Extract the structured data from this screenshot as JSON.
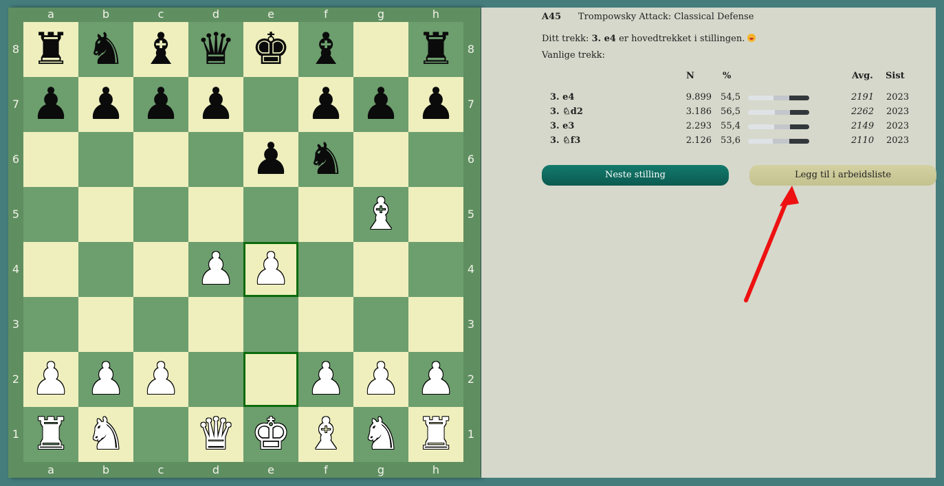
{
  "board": {
    "files": [
      "a",
      "b",
      "c",
      "d",
      "e",
      "f",
      "g",
      "h"
    ],
    "ranks": [
      "8",
      "7",
      "6",
      "5",
      "4",
      "3",
      "2",
      "1"
    ],
    "highlight_squares": [
      "e4",
      "e2"
    ],
    "pieces": {
      "a8": "bR",
      "b8": "bN",
      "c8": "bB",
      "d8": "bQ",
      "e8": "bK",
      "f8": "bB",
      "h8": "bR",
      "a7": "bP",
      "b7": "bP",
      "c7": "bP",
      "d7": "bP",
      "f7": "bP",
      "g7": "bP",
      "h7": "bP",
      "e6": "bP",
      "f6": "bN",
      "g5": "wB",
      "d4": "wP",
      "e4": "wP",
      "a2": "wP",
      "b2": "wP",
      "c2": "wP",
      "f2": "wP",
      "g2": "wP",
      "h2": "wP",
      "a1": "wR",
      "b1": "wN",
      "d1": "wQ",
      "e1": "wK",
      "f1": "wB",
      "g1": "wN",
      "h1": "wR"
    },
    "glyphs": {
      "K": "♚",
      "Q": "♛",
      "R": "♜",
      "B": "♝",
      "N": "♞",
      "P": "♟"
    }
  },
  "panel": {
    "eco": "A45",
    "opening": "Trompowsky Attack: Classical Defense",
    "your_move_prefix": "Ditt trekk: ",
    "your_move": "3. e4",
    "your_move_suffix": " er hovedtrekket i stillingen.",
    "common_moves_label": "Vanlige trekk:",
    "headers": {
      "n": "N",
      "pct": "%",
      "avg": "Avg.",
      "last": "Sist"
    },
    "moves": [
      {
        "move": "3. e4",
        "n": "9.899",
        "pct": "54,5",
        "white": 0.42,
        "draw": 0.25,
        "avg": "2191",
        "last": "2023"
      },
      {
        "move": "3. ♘d2",
        "n": "3.186",
        "pct": "56,5",
        "white": 0.44,
        "draw": 0.25,
        "avg": "2262",
        "last": "2023"
      },
      {
        "move": "3. e3",
        "n": "2.293",
        "pct": "55,4",
        "white": 0.43,
        "draw": 0.26,
        "avg": "2149",
        "last": "2023"
      },
      {
        "move": "3. ♘f3",
        "n": "2.126",
        "pct": "53,6",
        "white": 0.41,
        "draw": 0.26,
        "avg": "2110",
        "last": "2023"
      }
    ],
    "next_button": "Neste stilling",
    "add_button": "Legg til i arbeidsliste"
  },
  "colors": {
    "background": "#457d7d",
    "light_square": "#eeefbd",
    "dark_square": "#6d9e6e",
    "arrow": "#ee1111"
  }
}
